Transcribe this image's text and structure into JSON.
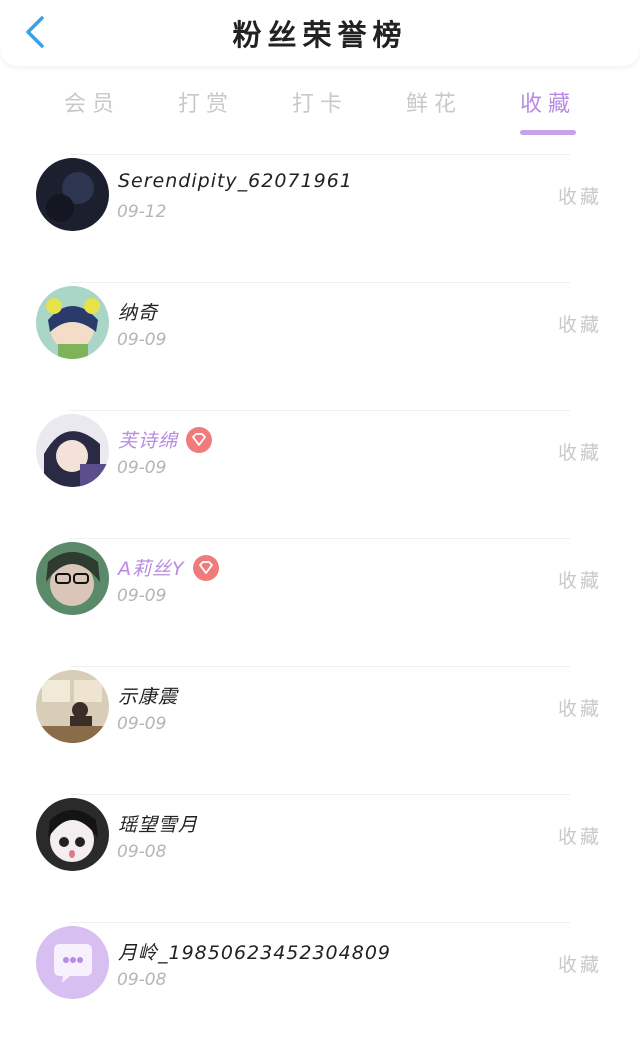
{
  "header": {
    "title": "粉丝荣誉榜",
    "back_icon": "chevron-left-icon"
  },
  "tabs": [
    {
      "label": "会员",
      "active": false
    },
    {
      "label": "打赏",
      "active": false
    },
    {
      "label": "打卡",
      "active": false
    },
    {
      "label": "鲜花",
      "active": false
    },
    {
      "label": "收藏",
      "active": true
    }
  ],
  "colors": {
    "accent": "#b98be3",
    "badge": "#f07b7b",
    "back": "#3aa0e8"
  },
  "fans": [
    {
      "name": "Serendipity_62071961",
      "date": "09-12",
      "action": "收藏",
      "vip": false
    },
    {
      "name": "纳奇",
      "date": "09-09",
      "action": "收藏",
      "vip": false
    },
    {
      "name": "芙诗绵",
      "date": "09-09",
      "action": "收藏",
      "vip": true
    },
    {
      "name": "A莉丝Y",
      "date": "09-09",
      "action": "收藏",
      "vip": true
    },
    {
      "name": "示康震",
      "date": "09-09",
      "action": "收藏",
      "vip": false
    },
    {
      "name": "瑶望雪月",
      "date": "09-08",
      "action": "收藏",
      "vip": false
    },
    {
      "name": "月岭_19850623452304809",
      "date": "09-08",
      "action": "收藏",
      "vip": false
    }
  ]
}
